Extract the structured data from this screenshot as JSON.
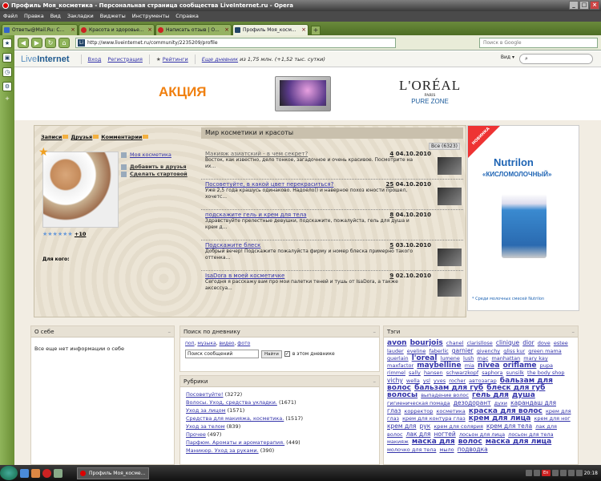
{
  "window": {
    "title": "Профиль Моя_косметика - Персональная страница сообщества LiveInternet.ru - Opera"
  },
  "menu": [
    "Файл",
    "Правка",
    "Вид",
    "Закладки",
    "Виджеты",
    "Инструменты",
    "Справка"
  ],
  "tabs": [
    {
      "label": "Ответы@Mail.Ru: С..."
    },
    {
      "label": "Красота и здоровье..."
    },
    {
      "label": "Написать отзыв | О..."
    },
    {
      "label": "Профиль Моя_косм..."
    }
  ],
  "address": {
    "url": "http://www.liveinternet.ru/community/2235209/profile",
    "search_placeholder": "Поиск в Google"
  },
  "li": {
    "logo_a": "Live",
    "logo_b": "Internet",
    "login": "Вход",
    "register": "Регистрация",
    "ratings": "Рейтинги",
    "tagline_a": "Еще дневник",
    "tagline_b": " из 1,75 млн. (+1,52 тыс. сутки)",
    "view": "Вид"
  },
  "banner": {
    "akcia": "АКЦИЯ",
    "brand": "L'ORÉAL",
    "brand_sub": "PARIS",
    "zone": "PURE ZONE"
  },
  "profile": {
    "tabs": [
      "Записи",
      "Друзья",
      "Комментарии"
    ],
    "name": "Моя косметика",
    "add_friend": "Добавить в друзья",
    "make_home": "Сделать стартовой",
    "rating": "+10",
    "for_whom": "Для кого:"
  },
  "feed": {
    "title": "Мир косметики и красоты",
    "all": "Все (6323)",
    "posts": [
      {
        "title": "Макияж азиатский - в чем секрет?",
        "count": "4",
        "date": "04.10.2010",
        "text": "Восток, как известно, дело тонкое, загадочное и очень красивое. Посмотрите на их..."
      },
      {
        "title": "Посоветуйте, в какой цвет перекраситься?",
        "count": "25",
        "date": "04.10.2010",
        "text": "Уже 2,5 года крашусь одинаково. Надоело)) и наверное похоз юности прошел, хочетс..."
      },
      {
        "title": "подскажите гель и крем для тела",
        "count": "8",
        "date": "04.10.2010",
        "text": "Здравствуйте прелестные девушки, подскажите, пожалуйста, гель для душа и крем д..."
      },
      {
        "title": "Подскажите блеск",
        "count": "5",
        "date": "03.10.2010",
        "text": "Добрый вечер! Подскажите пожалуйста фирму и номер блеска примерно такого оттенка..."
      },
      {
        "title": "IsaDora в моей косметичке",
        "count": "9",
        "date": "02.10.2010",
        "text": "Сегодня я расскажу вам про мои палетки теней и тушь от IsaDora, а также аксессуа..."
      }
    ]
  },
  "ad": {
    "badge": "НОВИНКА",
    "brand": "Nutrilon",
    "product": "«КИСЛОМОЛОЧНЫЙ»",
    "note": "* Среди молочных смесей Nutrilon"
  },
  "about": {
    "title": "О себе",
    "text": "Все еще нет информации о себе"
  },
  "search": {
    "title": "Поиск по дневнику",
    "filters": [
      "поп",
      "музыка",
      "видео",
      "фото"
    ],
    "input": "Поиск сообщений",
    "button": "Найти",
    "scope": "в этом дневнике"
  },
  "rubrics": {
    "title": "Рубрики",
    "items": [
      {
        "label": "Посоветуйте!",
        "count": "(3272)"
      },
      {
        "label": "Волосы. Уход, средства укладки.",
        "count": "(1671)"
      },
      {
        "label": "Уход за лицом",
        "count": "(1571)"
      },
      {
        "label": "Средства для макияжа, косметика.",
        "count": "(1517)"
      },
      {
        "label": "Уход за телом",
        "count": "(839)"
      },
      {
        "label": "Прочее",
        "count": "(497)"
      },
      {
        "label": "Парфюм. Ароматы и ароматерапия.",
        "count": "(449)"
      },
      {
        "label": "Маникюр. Уход за руками.",
        "count": "(390)"
      }
    ]
  },
  "tags": {
    "title": "Тэги",
    "items": [
      {
        "t": "avon",
        "s": "big"
      },
      {
        "t": "bourjois",
        "s": "big"
      },
      {
        "t": "chanel",
        "s": ""
      },
      {
        "t": "clarisllose",
        "s": ""
      },
      {
        "t": "clinique",
        "s": "med"
      },
      {
        "t": "dior",
        "s": "med"
      },
      {
        "t": "dove",
        "s": ""
      },
      {
        "t": "estee",
        "s": ""
      },
      {
        "t": "lauder",
        "s": ""
      },
      {
        "t": "eveline",
        "s": ""
      },
      {
        "t": "faberlic",
        "s": ""
      },
      {
        "t": "garnier",
        "s": "med"
      },
      {
        "t": "givenchy",
        "s": ""
      },
      {
        "t": "gliss kur",
        "s": ""
      },
      {
        "t": "green mama",
        "s": ""
      },
      {
        "t": "guerlain",
        "s": ""
      },
      {
        "t": "l'oreal",
        "s": "big"
      },
      {
        "t": "lumene",
        "s": ""
      },
      {
        "t": "lush",
        "s": ""
      },
      {
        "t": "mac",
        "s": ""
      },
      {
        "t": "manhattan",
        "s": ""
      },
      {
        "t": "mary kay",
        "s": ""
      },
      {
        "t": "maxfactor",
        "s": ""
      },
      {
        "t": "maybelline",
        "s": "big"
      },
      {
        "t": "mia",
        "s": ""
      },
      {
        "t": "nivea",
        "s": "big"
      },
      {
        "t": "oriflame",
        "s": "big"
      },
      {
        "t": "pupa",
        "s": ""
      },
      {
        "t": "rimmel",
        "s": ""
      },
      {
        "t": "sally",
        "s": ""
      },
      {
        "t": "hansen",
        "s": ""
      },
      {
        "t": "schwarzkopf",
        "s": ""
      },
      {
        "t": "saphora",
        "s": ""
      },
      {
        "t": "sunsilk",
        "s": ""
      },
      {
        "t": "the body shop",
        "s": ""
      },
      {
        "t": "vichy",
        "s": "med"
      },
      {
        "t": "wella",
        "s": ""
      },
      {
        "t": "ysl",
        "s": ""
      },
      {
        "t": "yves",
        "s": ""
      },
      {
        "t": "rocher",
        "s": ""
      },
      {
        "t": "автозагар",
        "s": ""
      },
      {
        "t": "бальзам для волос",
        "s": "big"
      },
      {
        "t": "бальзам для губ",
        "s": "big"
      },
      {
        "t": "блеск для губ",
        "s": "big"
      },
      {
        "t": "волосы",
        "s": "big"
      },
      {
        "t": "выпадение волос",
        "s": ""
      },
      {
        "t": "гель для",
        "s": "big"
      },
      {
        "t": "душа",
        "s": "big"
      },
      {
        "t": "гигиеническая помада",
        "s": ""
      },
      {
        "t": "дезодорант",
        "s": "med"
      },
      {
        "t": "духи",
        "s": ""
      },
      {
        "t": "карандаш для",
        "s": "med"
      },
      {
        "t": "глаз",
        "s": "med"
      },
      {
        "t": "корректор",
        "s": ""
      },
      {
        "t": "косметика",
        "s": ""
      },
      {
        "t": "краска для волос",
        "s": "big"
      },
      {
        "t": "крем для глаз",
        "s": ""
      },
      {
        "t": "крем для контура глаз",
        "s": ""
      },
      {
        "t": "крем для лица",
        "s": "big"
      },
      {
        "t": "крем для ног",
        "s": ""
      },
      {
        "t": "крем для",
        "s": "med"
      },
      {
        "t": "рук",
        "s": "med"
      },
      {
        "t": "крем для солярия",
        "s": ""
      },
      {
        "t": "крем для тела",
        "s": "med"
      },
      {
        "t": "лак для волос",
        "s": ""
      },
      {
        "t": "лак для",
        "s": "med"
      },
      {
        "t": "ногтей",
        "s": "med"
      },
      {
        "t": "лосьон для лица",
        "s": ""
      },
      {
        "t": "лосьон для тела",
        "s": ""
      },
      {
        "t": "макияж",
        "s": ""
      },
      {
        "t": "маска для",
        "s": "big"
      },
      {
        "t": "волос",
        "s": "big"
      },
      {
        "t": "маска для лица",
        "s": "big"
      },
      {
        "t": "молочко для тела",
        "s": ""
      },
      {
        "t": "мыло",
        "s": ""
      },
      {
        "t": "подводка",
        "s": "med"
      }
    ]
  },
  "taskbar": {
    "task": "Профиль Моя_косме...",
    "lang": "En",
    "clock": "20:18"
  }
}
